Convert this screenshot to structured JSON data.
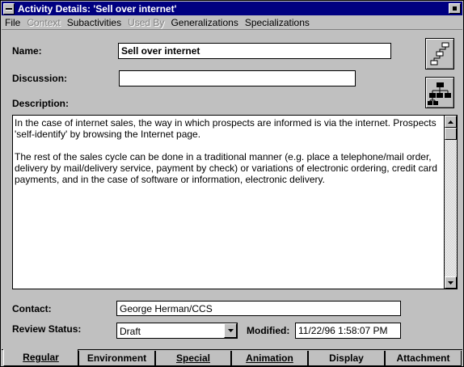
{
  "window": {
    "title": "Activity Details: 'Sell over internet'"
  },
  "menu": {
    "items": [
      {
        "label": "File",
        "enabled": true
      },
      {
        "label": "Context",
        "enabled": false
      },
      {
        "label": "Subactivities",
        "enabled": true
      },
      {
        "label": "Used By",
        "enabled": false
      },
      {
        "label": "Generalizations",
        "enabled": true
      },
      {
        "label": "Specializations",
        "enabled": true
      }
    ]
  },
  "form": {
    "name_label": "Name:",
    "name_value": "Sell over internet",
    "discussion_label": "Discussion:",
    "discussion_value": "",
    "description_label": "Description:",
    "description_paragraphs": [
      "In the case of internet sales, the way in which prospects are informed is via the internet. Prospects 'self-identify' by browsing the Internet page.",
      "The rest of the sales cycle can be done in a traditional manner (e.g. place a telephone/mail order, delivery by mail/delivery service, payment by check) or variations of electronic ordering, credit card payments, and in the case of software or information, electronic delivery."
    ],
    "contact_label": "Contact:",
    "contact_value": "George Herman/CCS",
    "review_status_label": "Review Status:",
    "review_status_value": "Draft",
    "modified_label": "Modified:",
    "modified_value": "11/22/96 1:58:07 PM"
  },
  "tabs": [
    {
      "label": "Regular",
      "active": true
    },
    {
      "label": "Environment",
      "active": false
    },
    {
      "label": "Special",
      "active": false
    },
    {
      "label": "Animation",
      "active": false
    },
    {
      "label": "Display",
      "active": false
    },
    {
      "label": "Attachment",
      "active": false
    }
  ],
  "icons": {
    "sysmenu": "system-menu-icon",
    "close": "close-icon",
    "process_flow": "process-flow-icon",
    "hierarchy": "hierarchy-icon",
    "dropdown": "dropdown-arrow-icon",
    "scroll_up": "scroll-up-icon",
    "scroll_down": "scroll-down-icon"
  }
}
